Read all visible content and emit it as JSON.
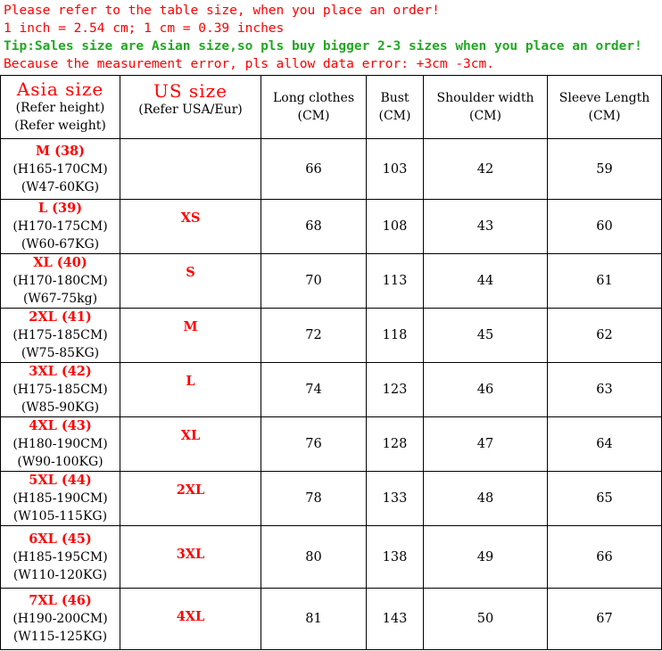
{
  "notes": [
    "Please refer to the table size, when you place an order!",
    "1 inch = 2.54 cm; 1 cm = 0.39 inches",
    "Tip:Sales size are Asian size,so pls buy bigger 2-3 sizes when you place an order!",
    "Because the measurement error, pls allow data error: +3cm -3cm."
  ],
  "colors": {
    "note_red": "#ff0000",
    "note_green": "#22a822",
    "size_red": "#ff0000"
  },
  "headers": {
    "asia_title": "Asia size",
    "asia_sub1": "(Refer height)",
    "asia_sub2": "(Refer weight)",
    "us_title": "US size",
    "us_sub": "(Refer USA/Eur)",
    "long_title": "Long clothes",
    "long_unit": "(CM)",
    "bust_title": "Bust",
    "bust_unit": "(CM)",
    "shoulder_title": "Shoulder width",
    "shoulder_unit": "(CM)",
    "sleeve_title": "Sleeve Length",
    "sleeve_unit": "(CM)"
  },
  "rows": [
    {
      "asia": "M (38)",
      "height": "(H165-170CM)",
      "weight": "(W47-60KG)",
      "us": "",
      "long": "66",
      "bust": "103",
      "shoulder": "42",
      "sleeve": "59"
    },
    {
      "asia": "L (39)",
      "height": "(H170-175CM)",
      "weight": "(W60-67KG)",
      "us": "XS",
      "long": "68",
      "bust": "108",
      "shoulder": "43",
      "sleeve": "60"
    },
    {
      "asia": "XL (40)",
      "height": "(H170-180CM)",
      "weight": "(W67-75kg)",
      "us": "S",
      "long": "70",
      "bust": "113",
      "shoulder": "44",
      "sleeve": "61"
    },
    {
      "asia": "2XL (41)",
      "height": "(H175-185CM)",
      "weight": "(W75-85KG)",
      "us": "M",
      "long": "72",
      "bust": "118",
      "shoulder": "45",
      "sleeve": "62"
    },
    {
      "asia": "3XL (42)",
      "height": "(H175-185CM)",
      "weight": "(W85-90KG)",
      "us": "L",
      "long": "74",
      "bust": "123",
      "shoulder": "46",
      "sleeve": "63"
    },
    {
      "asia": "4XL (43)",
      "height": "(H180-190CM)",
      "weight": "(W90-100KG)",
      "us": "XL",
      "long": "76",
      "bust": "128",
      "shoulder": "47",
      "sleeve": "64"
    },
    {
      "asia": "5XL (44)",
      "height": "(H185-190CM)",
      "weight": "(W105-115KG)",
      "us": "2XL",
      "long": "78",
      "bust": "133",
      "shoulder": "48",
      "sleeve": "65"
    },
    {
      "asia": "6XL (45)",
      "height": "(H185-195CM)",
      "weight": "(W110-120KG)",
      "us": "3XL",
      "long": "80",
      "bust": "138",
      "shoulder": "49",
      "sleeve": "66"
    },
    {
      "asia": "7XL (46)",
      "height": "(H190-200CM)",
      "weight": "(W115-125KG)",
      "us": "4XL",
      "long": "81",
      "bust": "143",
      "shoulder": "50",
      "sleeve": "67"
    }
  ]
}
